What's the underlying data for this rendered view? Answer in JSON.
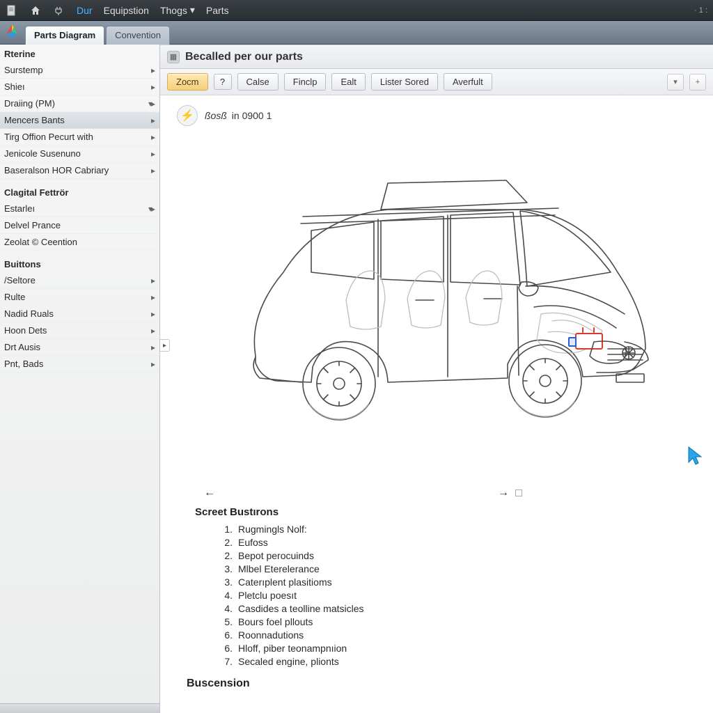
{
  "topbar": {
    "menus": [
      {
        "label": "Dur",
        "active": true
      },
      {
        "label": "Equipstion",
        "active": false
      },
      {
        "label": "Thogs",
        "active": false,
        "dropdown": true
      },
      {
        "label": "Parts",
        "active": false
      }
    ],
    "right_marker": "· 1 :"
  },
  "tabs": {
    "primary": "Parts Diagram",
    "secondary": "Convention"
  },
  "sidebar": {
    "groups": [
      {
        "header": "Rterine",
        "items": [
          {
            "label": "Surstemp",
            "chev": 1
          },
          {
            "label": "Shieı",
            "chev": 1
          },
          {
            "label": "Draiing (PM)",
            "chev": 2
          },
          {
            "label": "Mencers Bants",
            "chev": 1,
            "selected": true
          },
          {
            "label": "Tirg Offion Pecurt with",
            "chev": 1
          },
          {
            "label": "Jenicole Susenuno",
            "chev": 1
          },
          {
            "label": "Baseralson HOR Cabriary",
            "chev": 1
          }
        ]
      },
      {
        "header": "Clagital Fettrör",
        "items": [
          {
            "label": "Estarleı",
            "chev": 2
          },
          {
            "label": "Delvel Prance",
            "chev": 0
          },
          {
            "label": "Zeolat © Ceention",
            "chev": 0
          }
        ]
      },
      {
        "header": "Buittons",
        "items": [
          {
            "label": "/Seltore",
            "chev": 1
          },
          {
            "label": "Rulte",
            "chev": 1
          },
          {
            "label": "Nadid Ruals",
            "chev": 1
          },
          {
            "label": "Hoon Dets",
            "chev": 1
          },
          {
            "label": "Drt Ausis",
            "chev": 1
          },
          {
            "label": "Pnt, Bads",
            "chev": 1
          }
        ]
      }
    ]
  },
  "content": {
    "title": "Becalled per our parts",
    "toolbar": {
      "q_label": "?",
      "zoom": "Zocm",
      "calse": "Calse",
      "finclp": "Finclp",
      "ealt": "Ealt",
      "lister": "Lister Sored",
      "averfult": "Averfult",
      "dd": "▾",
      "plus": "+"
    },
    "meta": {
      "script": "ßosß",
      "rest": "in 0900 1"
    },
    "list_heading": "Screet Bustırons",
    "list": [
      {
        "num": "1.",
        "text": "Rugmingls Nolf:"
      },
      {
        "num": "2.",
        "text": "Eufoss"
      },
      {
        "num": "2.",
        "text": "Bepot perocuinds"
      },
      {
        "num": "3.",
        "text": "Mlbel Eterelerance"
      },
      {
        "num": "3.",
        "text": "Caterıplent plasitioms"
      },
      {
        "num": "4.",
        "text": "Pletclu poesıt"
      },
      {
        "num": "4.",
        "text": "Casdides a teolline matsicles"
      },
      {
        "num": "5.",
        "text": "Bours foel pllouts"
      },
      {
        "num": "6.",
        "text": "Roonnadutions"
      },
      {
        "num": "6.",
        "text": "Hloff, piber teonampnıion"
      },
      {
        "num": "7.",
        "text": "Secaled engine, plionts"
      }
    ],
    "footer_heading": "Buscension"
  }
}
